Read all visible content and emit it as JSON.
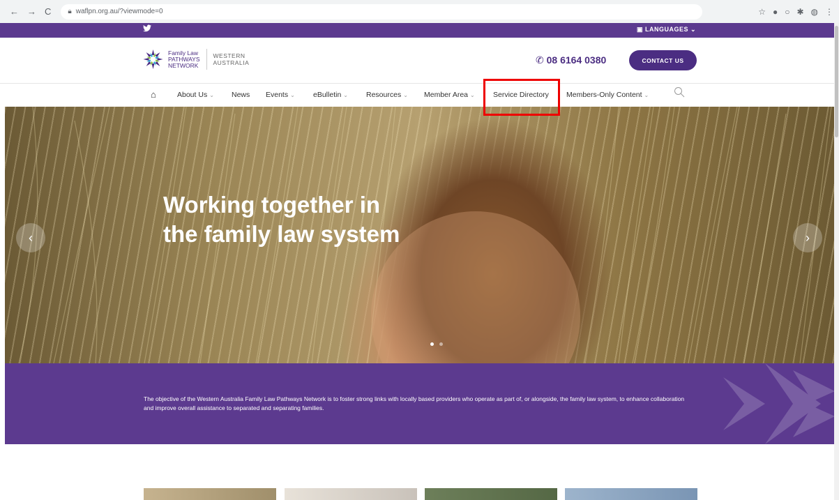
{
  "browser": {
    "url": "waflpn.org.au/?viewmode=0"
  },
  "topbar": {
    "languages_label": "LANGUAGES"
  },
  "header": {
    "logo_line1": "Family Law",
    "logo_line2": "PATHWAYS",
    "logo_line3": "NETWORK",
    "logo_region1": "WESTERN",
    "logo_region2": "AUSTRALIA",
    "phone": "08 6164 0380",
    "contact_label": "CONTACT US"
  },
  "menu": {
    "items": [
      {
        "label": "About Us"
      },
      {
        "label": "News"
      },
      {
        "label": "Events"
      },
      {
        "label": "eBulletin"
      },
      {
        "label": "Resources"
      },
      {
        "label": "Member Area"
      },
      {
        "label": "Service Directory"
      },
      {
        "label": "Members-Only Content"
      }
    ]
  },
  "hero": {
    "headline": "Working together in the family law system",
    "slide_count": 2,
    "active_slide": 1
  },
  "band": {
    "text": "The objective of the Western Australia Family Law Pathways Network is to foster strong links with locally based providers who operate as part of, or alongside, the family law system, to enhance collaboration and improve overall assistance to separated and separating families."
  },
  "colors": {
    "brand_purple": "#5c3a8f",
    "button_purple": "#4b2d82",
    "highlight_red": "#ee0000"
  }
}
